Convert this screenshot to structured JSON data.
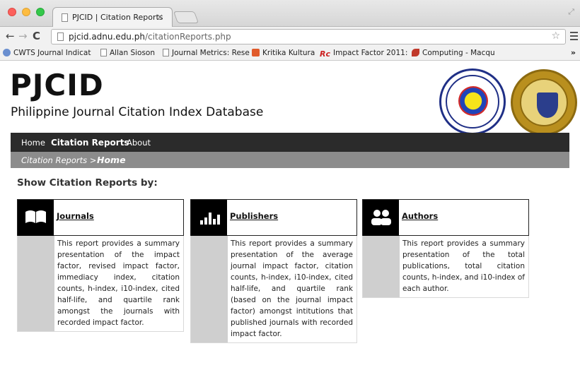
{
  "browser": {
    "tab_title": "PJCID | Citation Reports",
    "tab_close": "×",
    "url_host": "pjcid.adnu.edu.ph",
    "url_path": "/citationReports.php",
    "bookmarks": [
      {
        "label": "CWTS Journal Indicat",
        "icon": "globe-icon"
      },
      {
        "label": "Allan Sioson",
        "icon": "document-icon"
      },
      {
        "label": "Journal Metrics: Rese",
        "icon": "document-icon"
      },
      {
        "label": "Kritika Kultura",
        "icon": "sr-icon"
      },
      {
        "label": "Impact Factor 2011:",
        "icon": "rc-icon"
      },
      {
        "label": "Computing - Macqu",
        "icon": "leaf-icon"
      }
    ],
    "bookmarks_more": "»"
  },
  "header": {
    "title": "PJCID",
    "subtitle": "Philippine Journal Citation Index Database"
  },
  "nav": {
    "items": [
      "Home",
      "Citation Reports",
      "About"
    ]
  },
  "breadcrumb": {
    "parent": "Citation Reports >",
    "current": "Home"
  },
  "main": {
    "heading": "Show Citation Reports by:",
    "cards": [
      {
        "title": "Journals",
        "icon": "book-icon",
        "description": "This report provides a summary presentation of the impact factor, revised impact factor, immediacy index, citation counts, h-index, i10-index, cited half-life, and quartile rank amongst the journals with recorded impact factor."
      },
      {
        "title": "Publishers",
        "icon": "bar-chart-icon",
        "description": "This report provides a summary presentation of the average journal impact factor, citation counts, h-index, i10-index, cited half-life, and quartile rank (based on the journal impact factor) amongst intitutions that published journals with recorded impact factor."
      },
      {
        "title": "Authors",
        "icon": "users-icon",
        "description": "This report provides a summary presentation of the total publications, total citation counts, h-index, and i10-index of each author."
      }
    ]
  },
  "colors": {
    "navbar": "#2b2b2b",
    "breadcrumb_bar": "#8c8c8c",
    "card_sidebar": "#cfcfcf"
  }
}
